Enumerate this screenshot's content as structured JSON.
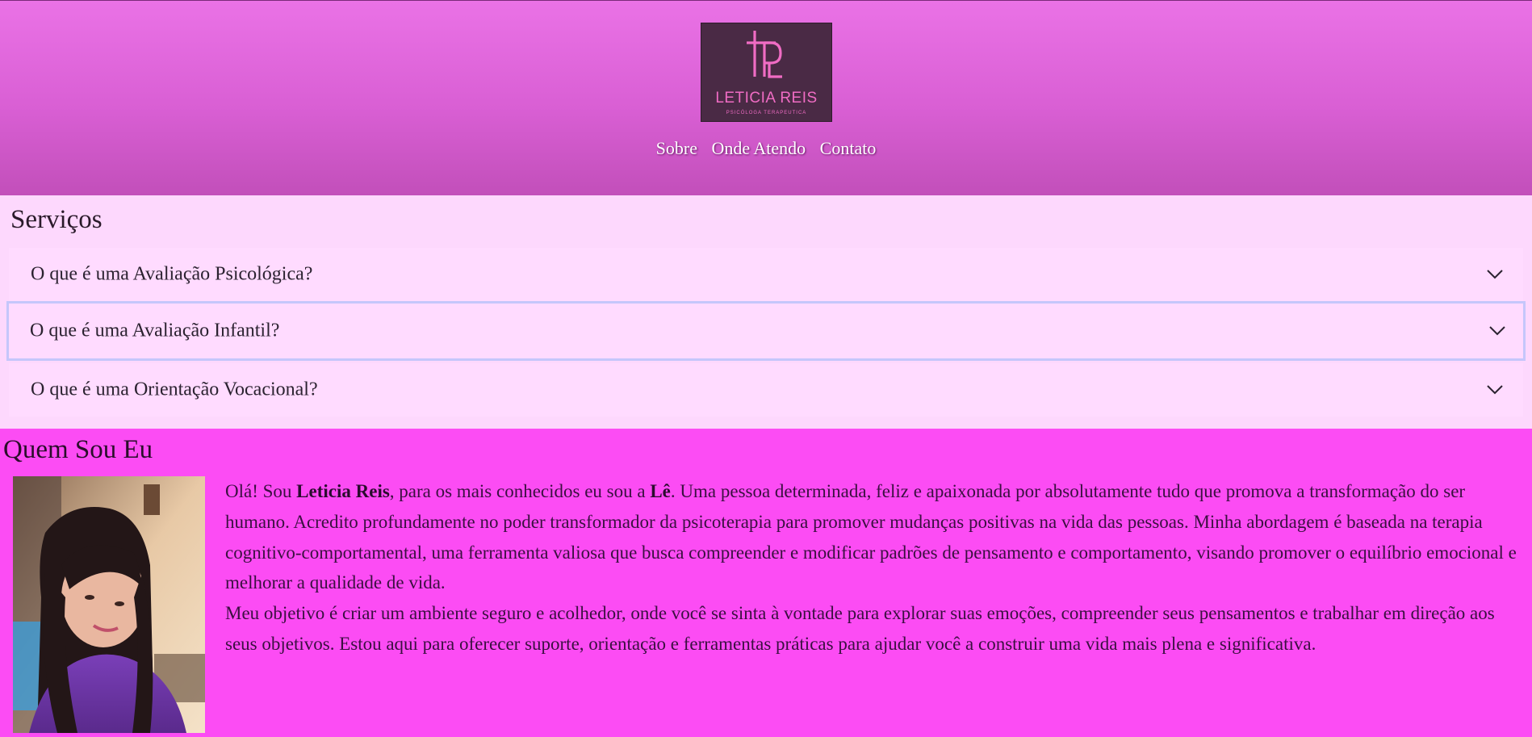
{
  "header": {
    "logo": {
      "monogram": "LR",
      "name": "LETICIA REIS",
      "subtitle": "PSICÓLOGA TERAPEUTICA"
    },
    "nav": [
      {
        "label": "Sobre"
      },
      {
        "label": "Onde Atendo"
      },
      {
        "label": "Contato"
      }
    ]
  },
  "services": {
    "title": "Serviços",
    "items": [
      {
        "label": "O que é uma Avaliação Psicológica?",
        "icon": "chevron-down-icon"
      },
      {
        "label": "O que é uma Avaliação Infantil?",
        "icon": "chevron-down-icon",
        "focused": true
      },
      {
        "label": "O que é uma Orientação Vocacional?",
        "icon": "chevron-down-icon"
      }
    ]
  },
  "about": {
    "title": "Quem Sou Eu",
    "photo_alt": "profile-photo",
    "p1_pre": "Olá! Sou ",
    "p1_name": "Leticia Reis",
    "p1_mid": ", para os mais conhecidos eu sou a ",
    "p1_nick": "Lê",
    "p1_post": ". Uma pessoa determinada, feliz e apaixonada por absolutamente tudo que promova a transformação do ser humano. Acredito profundamente no poder transformador da psicoterapia para promover mudanças positivas na vida das pessoas. Minha abordagem é baseada na terapia cognitivo-comportamental, uma ferramenta valiosa que busca compreender e modificar padrões de pensamento e comportamento, visando promover o equilíbrio emocional e melhorar a qualidade de vida.",
    "p2": "Meu objetivo é criar um ambiente seguro e acolhedor, onde você se sinta à vontade para explorar suas emoções, compreender seus pensamentos e trabalhar em direção aos seus objetivos. Estou aqui para oferecer suporte, orientação e ferramentas práticas para ajudar você a construir uma vida mais plena e significativa."
  },
  "colors": {
    "header_top": "#ea72e6",
    "header_bottom": "#c24fba",
    "services_bg": "#fdd8fd",
    "about_bg": "#fc4cf4",
    "logo_bg": "#4a2a45",
    "logo_accent": "#f06cc4",
    "focus_ring": "#c5c6fb"
  }
}
